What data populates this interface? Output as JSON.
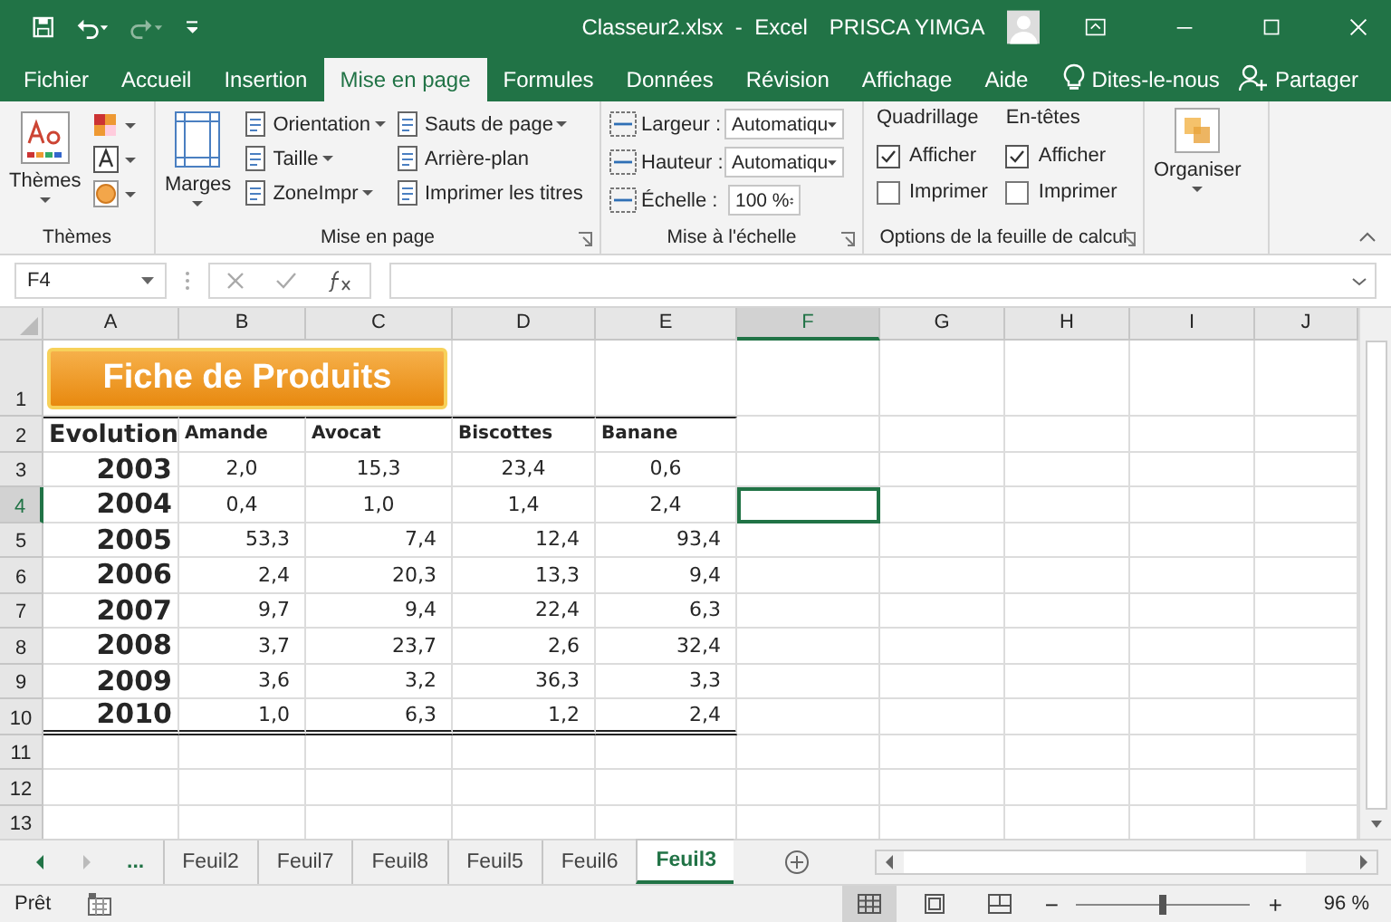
{
  "window": {
    "title": "Classeur2.xlsx  -  Excel",
    "user": "PRISCA YIMGA"
  },
  "tabs": [
    {
      "label": "Fichier",
      "selected": false
    },
    {
      "label": "Accueil",
      "selected": false
    },
    {
      "label": "Insertion",
      "selected": false
    },
    {
      "label": "Mise en page",
      "selected": true
    },
    {
      "label": "Formules",
      "selected": false
    },
    {
      "label": "Données",
      "selected": false
    },
    {
      "label": "Révision",
      "selected": false
    },
    {
      "label": "Affichage",
      "selected": false
    },
    {
      "label": "Aide",
      "selected": false
    }
  ],
  "tell_me": "Dites-le-nous",
  "share": "Partager",
  "ribbon": {
    "groups": [
      {
        "kind": "themes",
        "label": "Thèmes",
        "button": "Thèmes"
      },
      {
        "kind": "page_setup",
        "label": "Mise en page",
        "big_button": "Marges",
        "buttons": [
          {
            "label": "Orientation",
            "dropdown": true
          },
          {
            "label": "Taille",
            "dropdown": true
          },
          {
            "label": "ZoneImpr",
            "dropdown": true
          },
          {
            "label": "Sauts de page",
            "dropdown": true
          },
          {
            "label": "Arrière-plan",
            "dropdown": false
          },
          {
            "label": "Imprimer les titres",
            "dropdown": false
          }
        ]
      },
      {
        "kind": "scale",
        "label": "Mise à l'échelle",
        "fields": [
          {
            "label": "Largeur :",
            "value": "Automatiqu",
            "kind": "dropdown"
          },
          {
            "label": "Hauteur :",
            "value": "Automatiqu",
            "kind": "dropdown"
          },
          {
            "label": "Échelle :",
            "value": "100 %",
            "kind": "spinner"
          }
        ]
      },
      {
        "kind": "sheet_options",
        "label": "Options de la feuille de calcul",
        "columns": [
          {
            "heading": "Quadrillage",
            "options": [
              {
                "label": "Afficher",
                "checked": true
              },
              {
                "label": "Imprimer",
                "checked": false
              }
            ]
          },
          {
            "heading": "En-têtes",
            "options": [
              {
                "label": "Afficher",
                "checked": true
              },
              {
                "label": "Imprimer",
                "checked": false
              }
            ]
          }
        ]
      },
      {
        "kind": "arrange",
        "button": "Organiser"
      }
    ]
  },
  "name_box": "F4",
  "columns": [
    {
      "label": "A",
      "selected": false
    },
    {
      "label": "B",
      "selected": false
    },
    {
      "label": "C",
      "selected": false
    },
    {
      "label": "D",
      "selected": false
    },
    {
      "label": "E",
      "selected": false
    },
    {
      "label": "F",
      "selected": true
    },
    {
      "label": "G",
      "selected": false
    },
    {
      "label": "H",
      "selected": false
    },
    {
      "label": "I",
      "selected": false
    },
    {
      "label": "J",
      "selected": false
    }
  ],
  "rows": [
    {
      "number": "1",
      "selected": false,
      "kind": "title",
      "title": "Fiche de Produits"
    },
    {
      "number": "2",
      "selected": false,
      "kind": "header",
      "cells": [
        "Evolution",
        "Amande",
        "Avocat",
        "Biscottes",
        "Banane"
      ]
    },
    {
      "number": "3",
      "selected": false,
      "kind": "data_center",
      "cells": [
        "2003",
        "2,0",
        "15,3",
        "23,4",
        "0,6"
      ]
    },
    {
      "number": "4",
      "selected": true,
      "kind": "data_center",
      "cells": [
        "2004",
        "0,4",
        "1,0",
        "1,4",
        "2,4"
      ]
    },
    {
      "number": "5",
      "selected": false,
      "kind": "data_right",
      "cells": [
        "2005",
        "53,3",
        "7,4",
        "12,4",
        "93,4"
      ]
    },
    {
      "number": "6",
      "selected": false,
      "kind": "data_right",
      "cells": [
        "2006",
        "2,4",
        "20,3",
        "13,3",
        "9,4"
      ]
    },
    {
      "number": "7",
      "selected": false,
      "kind": "data_right",
      "cells": [
        "2007",
        "9,7",
        "9,4",
        "22,4",
        "6,3"
      ]
    },
    {
      "number": "8",
      "selected": false,
      "kind": "data_right",
      "cells": [
        "2008",
        "3,7",
        "23,7",
        "2,6",
        "32,4"
      ]
    },
    {
      "number": "9",
      "selected": false,
      "kind": "data_right",
      "cells": [
        "2009",
        "3,6",
        "3,2",
        "36,3",
        "3,3"
      ]
    },
    {
      "number": "10",
      "selected": false,
      "kind": "data_right",
      "cells": [
        "2010",
        "1,0",
        "6,3",
        "1,2",
        "2,4"
      ]
    },
    {
      "number": "11",
      "selected": false,
      "kind": "empty"
    },
    {
      "number": "12",
      "selected": false,
      "kind": "empty"
    },
    {
      "number": "13",
      "selected": false,
      "kind": "empty"
    }
  ],
  "sheet_tabs": {
    "more": "...",
    "tabs": [
      {
        "label": "Feuil2",
        "selected": false
      },
      {
        "label": "Feuil7",
        "selected": false
      },
      {
        "label": "Feuil8",
        "selected": false
      },
      {
        "label": "Feuil5",
        "selected": false
      },
      {
        "label": "Feuil6",
        "selected": false
      },
      {
        "label": "Feuil3",
        "selected": true
      }
    ]
  },
  "status_bar": {
    "status": "Prêt",
    "zoom_out": "−",
    "zoom_in": "+",
    "zoom": {
      "level": 0.5
    },
    "zoom_reading": "96 %"
  }
}
